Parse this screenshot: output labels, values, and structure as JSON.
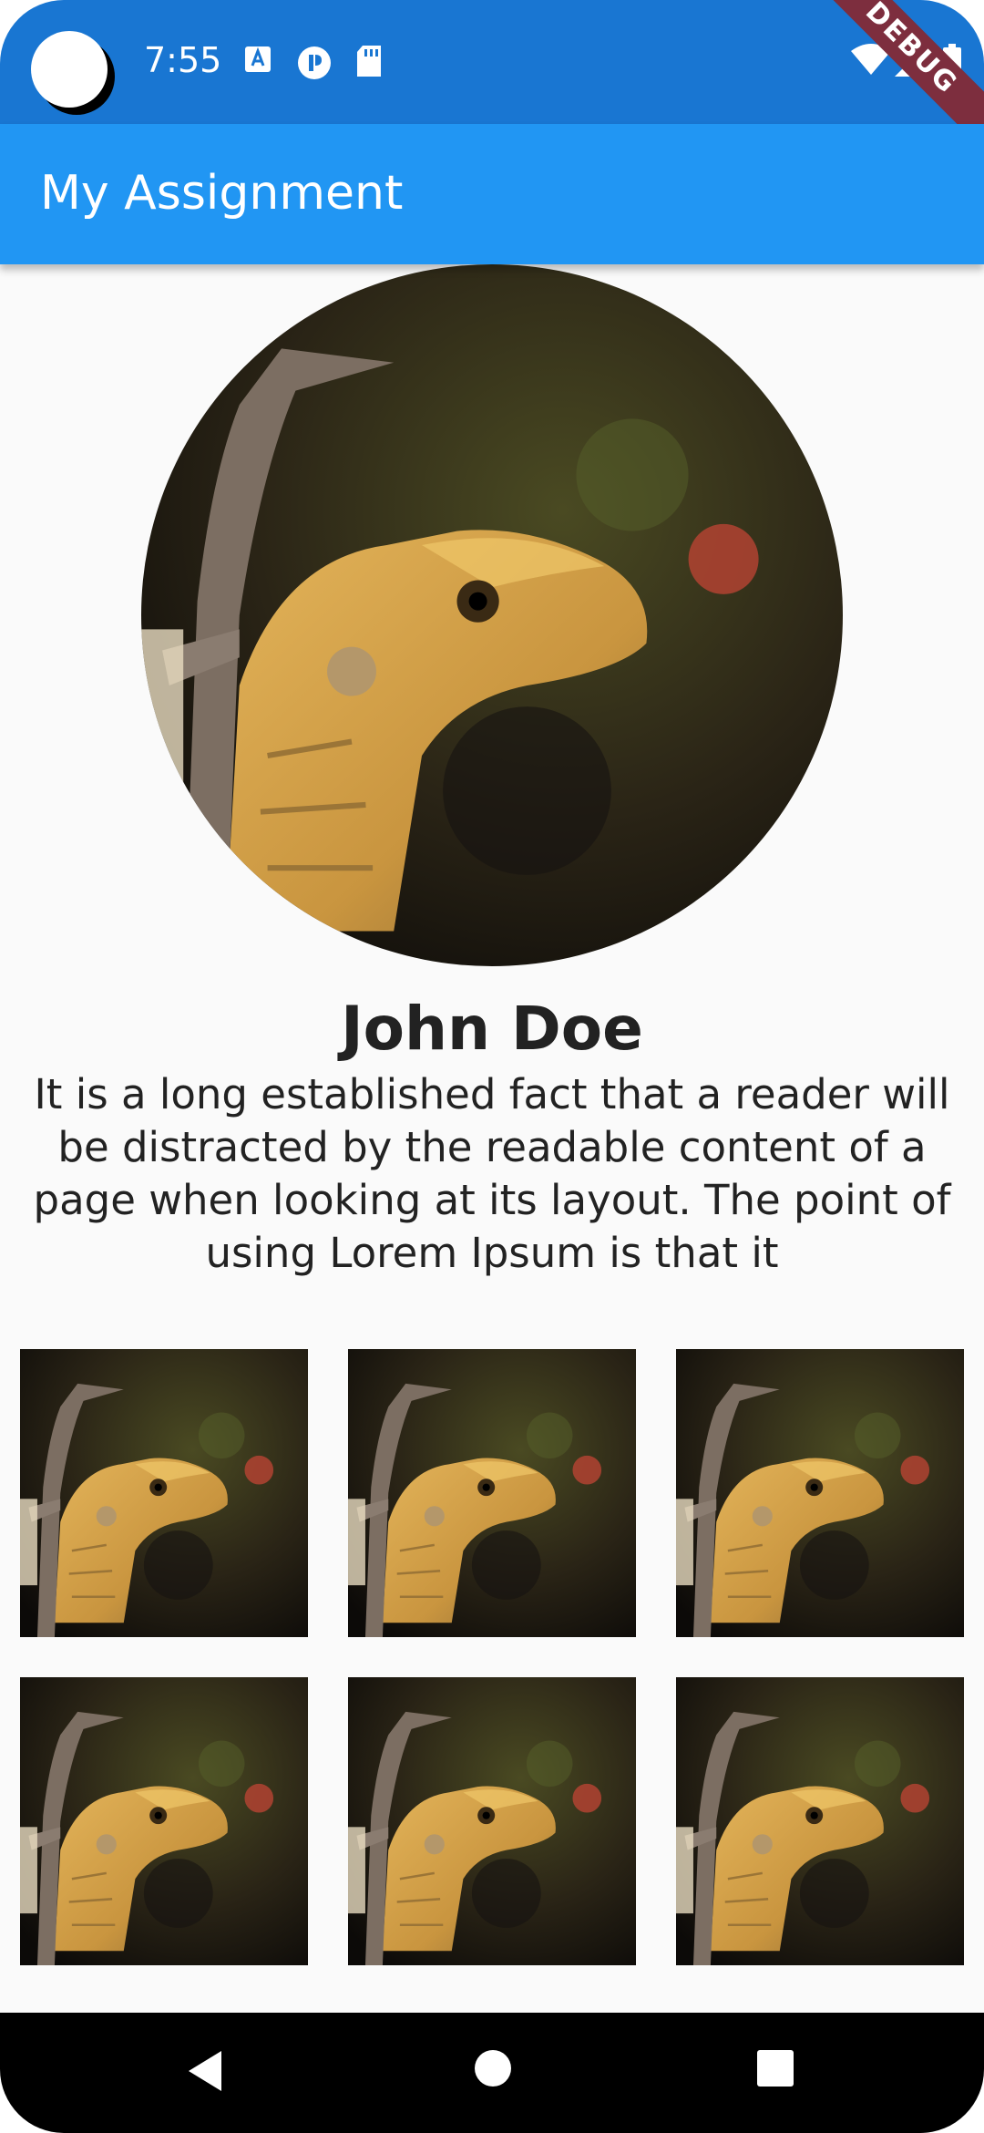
{
  "status_bar": {
    "time": "7:55",
    "left_icons": [
      "text-a-icon",
      "info-circle-icon",
      "sd-card-icon"
    ],
    "right_icons": [
      "wifi-icon",
      "cellular-signal-icon",
      "battery-icon"
    ],
    "debug_label": "DEBUG"
  },
  "app_bar": {
    "title": "My Assignment",
    "color": "#2196f3"
  },
  "profile": {
    "name": "John Doe",
    "bio": "It is a long established fact that a reader will be distracted by the readable content of a page when looking at its layout. The point of using Lorem Ipsum is that it",
    "avatar_image": "lizard-photo"
  },
  "gallery": {
    "images": [
      "lizard-photo",
      "lizard-photo",
      "lizard-photo",
      "lizard-photo",
      "lizard-photo",
      "lizard-photo"
    ]
  },
  "nav_bar": {
    "buttons": [
      "back-icon",
      "home-icon",
      "recents-icon"
    ]
  }
}
